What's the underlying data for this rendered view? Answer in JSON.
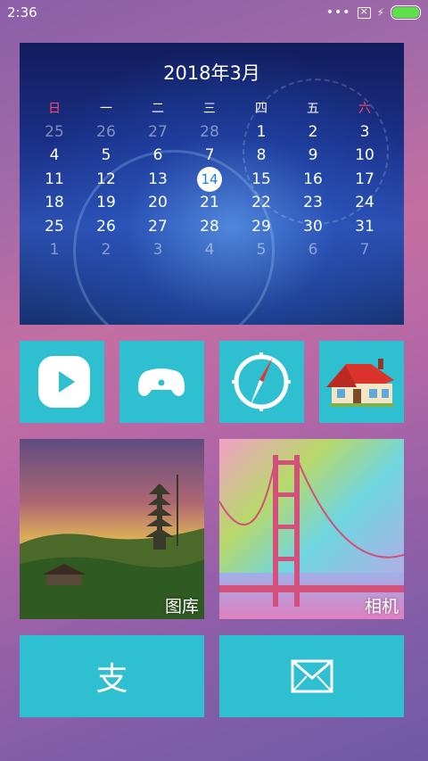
{
  "status_bar": {
    "time": "2:36",
    "icons": [
      "more-dots-icon",
      "no-sim-icon",
      "charging-bolt-icon",
      "battery-icon"
    ],
    "battery_color": "#5ee04a"
  },
  "calendar": {
    "title": "2018年3月",
    "weekdays": [
      "日",
      "一",
      "二",
      "三",
      "四",
      "五",
      "六"
    ],
    "weeks": [
      [
        "25",
        "26",
        "27",
        "28",
        "1",
        "2",
        "3"
      ],
      [
        "4",
        "5",
        "6",
        "7",
        "8",
        "9",
        "10"
      ],
      [
        "11",
        "12",
        "13",
        "14",
        "15",
        "16",
        "17"
      ],
      [
        "18",
        "19",
        "20",
        "21",
        "22",
        "23",
        "24"
      ],
      [
        "25",
        "26",
        "27",
        "28",
        "29",
        "30",
        "31"
      ],
      [
        "1",
        "2",
        "3",
        "4",
        "5",
        "6",
        "7"
      ]
    ],
    "today": "14",
    "accent_weekend": "#ff4a6a"
  },
  "tiles": {
    "accent": "#2ebfd0",
    "apps": [
      {
        "icon": "video-play-icon"
      },
      {
        "icon": "gamepad-icon"
      },
      {
        "icon": "compass-icon"
      },
      {
        "icon": "house-icon"
      }
    ],
    "gallery": {
      "label": "图库",
      "icon": "pagoda-photo"
    },
    "camera": {
      "label": "相机",
      "icon": "bridge-photo"
    },
    "alipay": {
      "glyph": "支"
    },
    "mail": {
      "icon": "envelope-icon"
    }
  }
}
